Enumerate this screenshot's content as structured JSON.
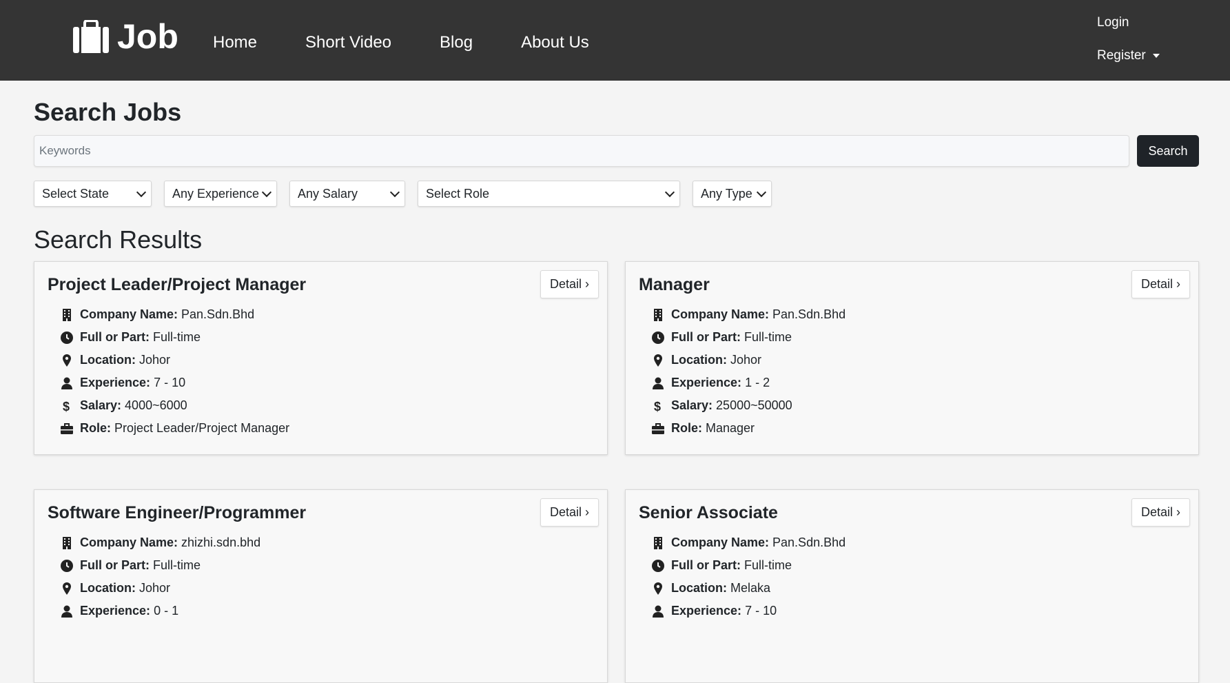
{
  "brand": {
    "name": "Job"
  },
  "nav": {
    "links": [
      "Home",
      "Short Video",
      "Blog",
      "About Us"
    ],
    "login": "Login",
    "register": "Register"
  },
  "search": {
    "title": "Search Jobs",
    "placeholder": "Keywords",
    "button": "Search"
  },
  "filters": [
    "Select State",
    "Any Experience",
    "Any Salary",
    "Select Role",
    "Any Type"
  ],
  "results": {
    "title": "Search Results",
    "detail_label": "Detail ›",
    "labels": {
      "company": "Company Name:",
      "type": "Full or Part:",
      "location": "Location:",
      "experience": "Experience:",
      "salary": "Salary:",
      "role": "Role:"
    },
    "jobs": [
      {
        "title": "Project Leader/Project Manager",
        "company": "Pan.Sdn.Bhd",
        "type": "Full-time",
        "location": "Johor",
        "experience": "7 - 10",
        "salary": "4000~6000",
        "role": "Project Leader/Project Manager"
      },
      {
        "title": "Manager",
        "company": "Pan.Sdn.Bhd",
        "type": "Full-time",
        "location": "Johor",
        "experience": "1 - 2",
        "salary": "25000~50000",
        "role": "Manager"
      },
      {
        "title": "Software Engineer/Programmer",
        "company": "zhizhi.sdn.bhd",
        "type": "Full-time",
        "location": "Johor",
        "experience": "0 - 1"
      },
      {
        "title": "Senior Associate",
        "company": "Pan.Sdn.Bhd",
        "type": "Full-time",
        "location": "Melaka",
        "experience": "7 - 10"
      }
    ]
  },
  "colors": {
    "navbar": "#343434",
    "page_bg": "#f4f4f4",
    "search_button": "#1f2328"
  }
}
